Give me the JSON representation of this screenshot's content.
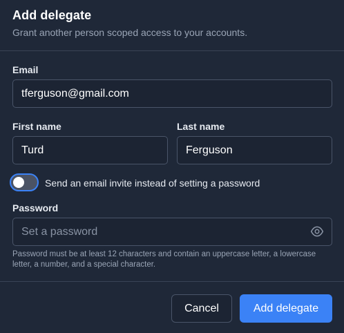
{
  "dialog": {
    "title": "Add delegate",
    "subtitle": "Grant another person scoped access to your accounts."
  },
  "form": {
    "email": {
      "label": "Email",
      "value": "tferguson@gmail.com"
    },
    "first_name": {
      "label": "First name",
      "value": "Turd"
    },
    "last_name": {
      "label": "Last name",
      "value": "Ferguson"
    },
    "invite_toggle": {
      "label": "Send an email invite instead of setting a password",
      "checked": false
    },
    "password": {
      "label": "Password",
      "value": "",
      "placeholder": "Set a password",
      "hint": "Password must be at least 12 characters and contain an uppercase letter, a lowercase letter, a number, and a special character."
    }
  },
  "actions": {
    "cancel_label": "Cancel",
    "submit_label": "Add delegate"
  },
  "colors": {
    "background": "#1f2838",
    "accent": "#3b82f6",
    "border": "#4a5569"
  },
  "icons": {
    "password_visibility": "eye-icon"
  }
}
